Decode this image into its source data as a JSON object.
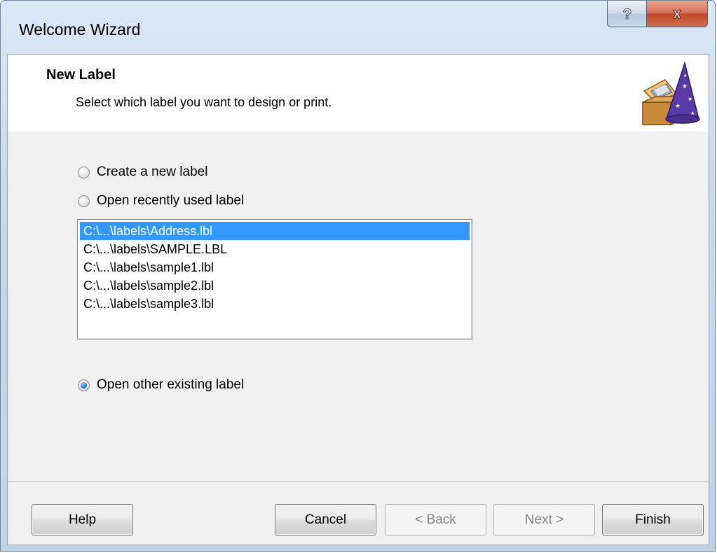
{
  "window": {
    "title": "Welcome Wizard",
    "help_glyph": "?",
    "close_glyph": "x"
  },
  "header": {
    "title": "New Label",
    "subtitle": "Select which label you want to design or print.",
    "icon": "wizard-hat-icon"
  },
  "options": {
    "create_new": "Create a new label",
    "open_recent": "Open recently used label",
    "open_other": "Open other existing label",
    "selected": "open_other"
  },
  "recent_files": [
    "C:\\...\\labels\\Address.lbl",
    "C:\\...\\labels\\SAMPLE.LBL",
    "C:\\...\\labels\\sample1.lbl",
    "C:\\...\\labels\\sample2.lbl",
    "C:\\...\\labels\\sample3.lbl"
  ],
  "selected_file_index": 0,
  "buttons": {
    "help": "Help",
    "cancel": "Cancel",
    "back": "< Back",
    "next": "Next >",
    "finish": "Finish"
  },
  "colors": {
    "selection": "#3399ff",
    "close_button": "#c7502f",
    "header_background": "#ffffff",
    "dialog_background": "#f0f0f0"
  }
}
